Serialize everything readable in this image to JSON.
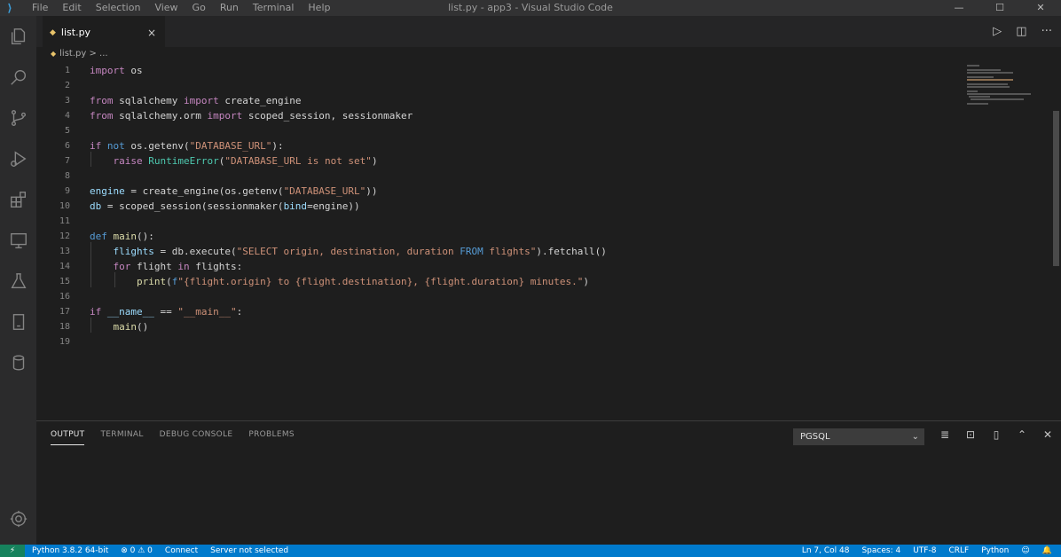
{
  "app": {
    "window_title": "list.py - app3 - Visual Studio Code",
    "menu": [
      "File",
      "Edit",
      "Selection",
      "View",
      "Go",
      "Run",
      "Terminal",
      "Help"
    ],
    "window_controls": {
      "minimize": "—",
      "maximize": "☐",
      "close": "✕"
    }
  },
  "activity_bar": {
    "icons": [
      "explorer-icon",
      "search-icon",
      "source-control-icon",
      "run-debug-icon",
      "extensions-icon",
      "remote-explorer-icon",
      "testing-icon",
      "notebook-icon",
      "database-icon"
    ],
    "bottom_icon": "settings-gear-icon"
  },
  "tabs": [
    {
      "icon": "py",
      "label": "list.py",
      "close": "×"
    }
  ],
  "tab_actions": {
    "run": "▷",
    "split": "◫",
    "more": "···"
  },
  "breadcrumb": {
    "icon": "py",
    "file": "list.py",
    "sep": "> ..."
  },
  "editor": {
    "current_line": 7,
    "lines": [
      {
        "n": "1",
        "tokens": [
          [
            "kw",
            "import"
          ],
          [
            "",
            " os"
          ]
        ]
      },
      {
        "n": "2",
        "tokens": []
      },
      {
        "n": "3",
        "tokens": [
          [
            "kw",
            "from"
          ],
          [
            "",
            " sqlalchemy "
          ],
          [
            "kw",
            "import"
          ],
          [
            "",
            " create_engine"
          ]
        ]
      },
      {
        "n": "4",
        "tokens": [
          [
            "kw",
            "from"
          ],
          [
            "",
            " sqlalchemy.orm "
          ],
          [
            "kw",
            "import"
          ],
          [
            "",
            " scoped_session, sessionmaker"
          ]
        ]
      },
      {
        "n": "5",
        "tokens": []
      },
      {
        "n": "6",
        "tokens": [
          [
            "kw",
            "if"
          ],
          [
            "kw2",
            " not"
          ],
          [
            "",
            " os.getenv("
          ],
          [
            "str",
            "\"DATABASE_URL\""
          ],
          [
            "",
            "):"
          ]
        ]
      },
      {
        "n": "7",
        "tokens": [
          [
            "",
            "    "
          ],
          [
            "kw",
            "raise"
          ],
          [
            "",
            " "
          ],
          [
            "cls",
            "RuntimeError"
          ],
          [
            "",
            "("
          ],
          [
            "str",
            "\"DATABASE_URL is not set\""
          ],
          [
            "",
            ")"
          ]
        ]
      },
      {
        "n": "8",
        "tokens": []
      },
      {
        "n": "9",
        "tokens": [
          [
            "var",
            "engine"
          ],
          [
            "",
            " = create_engine(os.getenv("
          ],
          [
            "str",
            "\"DATABASE_URL\""
          ],
          [
            "",
            "))"
          ]
        ]
      },
      {
        "n": "10",
        "tokens": [
          [
            "var",
            "db"
          ],
          [
            "",
            " = scoped_session(sessionmaker("
          ],
          [
            "var",
            "bind"
          ],
          [
            "",
            "=engine))"
          ]
        ]
      },
      {
        "n": "11",
        "tokens": []
      },
      {
        "n": "12",
        "tokens": [
          [
            "kw2",
            "def"
          ],
          [
            "fn",
            " main"
          ],
          [
            "",
            "():"
          ]
        ]
      },
      {
        "n": "13",
        "tokens": [
          [
            "",
            "    "
          ],
          [
            "var",
            "flights"
          ],
          [
            "",
            " = db.execute("
          ],
          [
            "str",
            "\"SELECT origin, destination, duration "
          ],
          [
            "kw2",
            "FROM"
          ],
          [
            "str",
            " flights\""
          ],
          [
            "",
            ").fetchall()"
          ]
        ]
      },
      {
        "n": "14",
        "tokens": [
          [
            "",
            "    "
          ],
          [
            "kw",
            "for"
          ],
          [
            "",
            " flight "
          ],
          [
            "kw",
            "in"
          ],
          [
            "",
            " flights:"
          ]
        ]
      },
      {
        "n": "15",
        "tokens": [
          [
            "",
            "        "
          ],
          [
            "fn",
            "print"
          ],
          [
            "",
            "("
          ],
          [
            "kw2",
            "f"
          ],
          [
            "str",
            "\"{flight.origin} to {flight.destination}, {flight.duration} minutes.\""
          ],
          [
            "",
            ")"
          ]
        ]
      },
      {
        "n": "16",
        "tokens": []
      },
      {
        "n": "17",
        "tokens": [
          [
            "kw",
            "if"
          ],
          [
            "var",
            " __name__"
          ],
          [
            "",
            " == "
          ],
          [
            "str",
            "\"__main__\""
          ],
          [
            "",
            ":"
          ]
        ]
      },
      {
        "n": "18",
        "tokens": [
          [
            "",
            "    "
          ],
          [
            "fn",
            "main"
          ],
          [
            "",
            "()"
          ]
        ]
      },
      {
        "n": "19",
        "tokens": []
      }
    ]
  },
  "panel": {
    "tabs": [
      "OUTPUT",
      "TERMINAL",
      "DEBUG CONSOLE",
      "PROBLEMS"
    ],
    "active_tab": "OUTPUT",
    "channel": "PGSQL",
    "actions": [
      "clear-output-icon",
      "lock-scroll-icon",
      "open-output-icon",
      "maximize-panel-icon",
      "close-panel-icon"
    ]
  },
  "status_bar": {
    "remote": "⚡",
    "interpreter": "Python 3.8.2 64-bit",
    "problems": "⊗ 0  ⚠ 0",
    "connect": "Connect",
    "server": "Server not selected",
    "position": "Ln 7, Col 48",
    "spaces": "Spaces: 4",
    "encoding": "UTF-8",
    "eol": "CRLF",
    "language": "Python",
    "feedback": "☺",
    "bell": "🔔"
  }
}
